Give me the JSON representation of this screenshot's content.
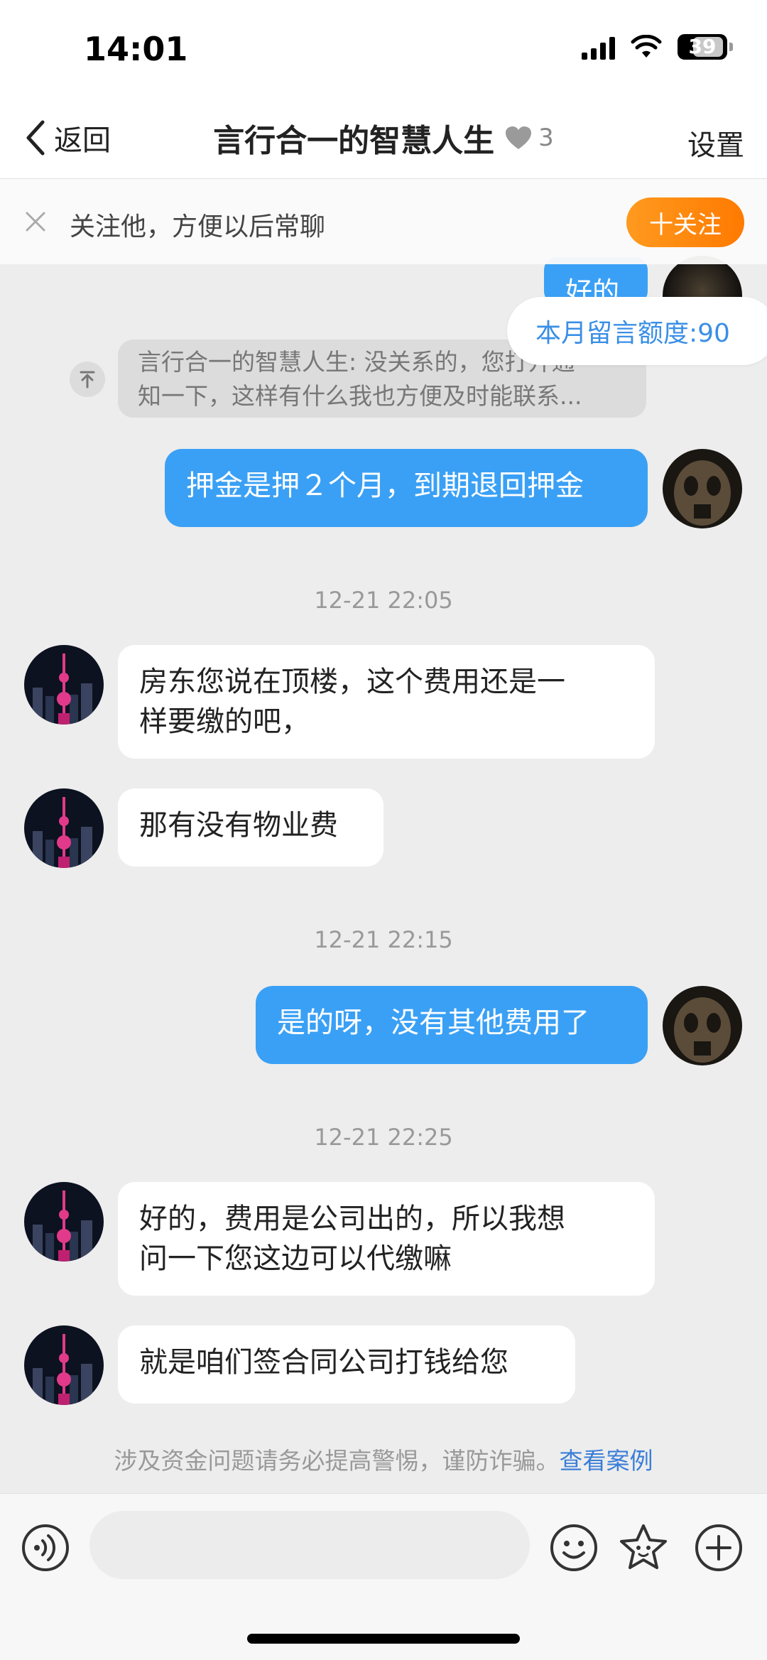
{
  "status_bar": {
    "time": "14:01",
    "battery": "39"
  },
  "nav": {
    "back_label": "返回",
    "title": "言行合一的智慧人生",
    "count": "3",
    "settings_label": "设置"
  },
  "follow_bar": {
    "text": "关注他，方便以后常聊",
    "button_label": "十关注"
  },
  "quota": {
    "label": "本月留言额度:90"
  },
  "peek": {
    "outgoing_text": "好的"
  },
  "quote": {
    "line1": "言行合一的智慧人生: 没关系的，您打开通",
    "line2": "知一下，这样有什么我也方便及时能联系..."
  },
  "messages": {
    "m1": {
      "line1": "押金是押２个月，到期退回押金"
    },
    "t1": "12-21 22:05",
    "m2": {
      "line1": "房东您说在顶楼，这个费用还是一",
      "line2": "样要缴的吧，"
    },
    "m3": {
      "line1": "那有没有物业费"
    },
    "t2": "12-21 22:15",
    "m4": {
      "line1": "是的呀，没有其他费用了"
    },
    "t3": "12-21 22:25",
    "m5": {
      "line1": "好的，费用是公司出的，所以我想",
      "line2": "问一下您这边可以代缴嘛"
    },
    "m6": {
      "line1": "就是咱们签合同公司打钱给您"
    }
  },
  "warning": {
    "text": "涉及资金问题请务必提高警惕，谨防诈骗。",
    "link": "查看案例"
  },
  "toolbar": {
    "input_placeholder": ""
  },
  "colors": {
    "outgoing_bubble": "#3aa0f5",
    "follow_button": "#ff8a00",
    "link": "#3a7ed8"
  }
}
